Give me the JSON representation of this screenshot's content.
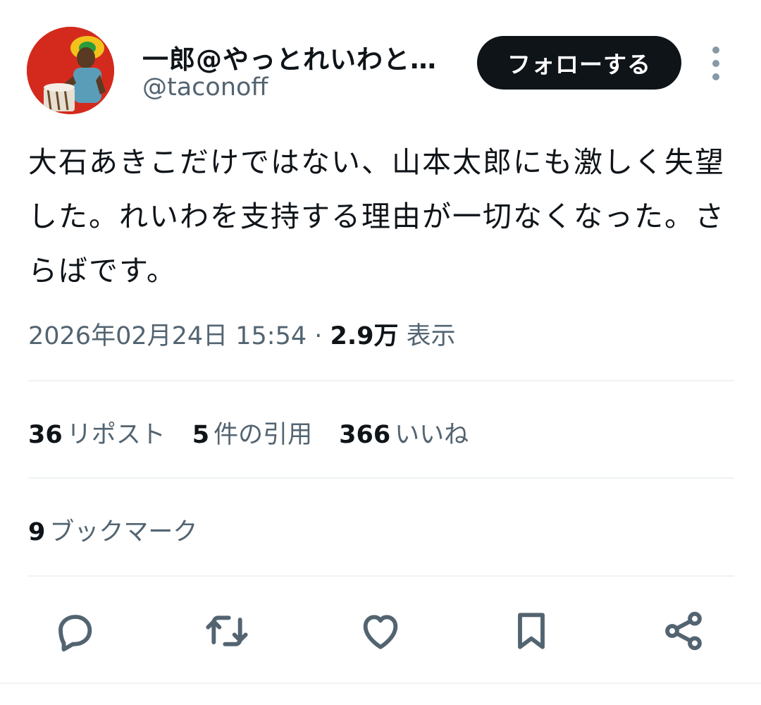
{
  "user": {
    "display_name": "一郎@やっとれいわと…",
    "handle": "@taconoff"
  },
  "follow_button": {
    "label": "フォローする"
  },
  "tweet": {
    "text": "大石あきこだけではない、山本太郎にも激しく失望した。れいわを支持する理由が一切なくなった。さらばです。",
    "timestamp": "2026年02月24日 15:54",
    "separator": " · ",
    "views_count": "2.9万",
    "views_label": " 表示"
  },
  "stats": {
    "reposts": {
      "num": "36",
      "label": "リポスト"
    },
    "quotes": {
      "num": "5",
      "label": "件の引用"
    },
    "likes": {
      "num": "366",
      "label": "いいね"
    }
  },
  "bookmarks": {
    "num": "9",
    "label": "ブックマーク"
  },
  "colors": {
    "text_primary": "#0f1419",
    "text_secondary": "#536471",
    "icon": "#536471",
    "divider": "#eff3f4",
    "button_bg": "#0f1419"
  },
  "icons": [
    "more-vertical-icon",
    "reply-icon",
    "repost-icon",
    "like-icon",
    "bookmark-icon",
    "share-icon"
  ]
}
